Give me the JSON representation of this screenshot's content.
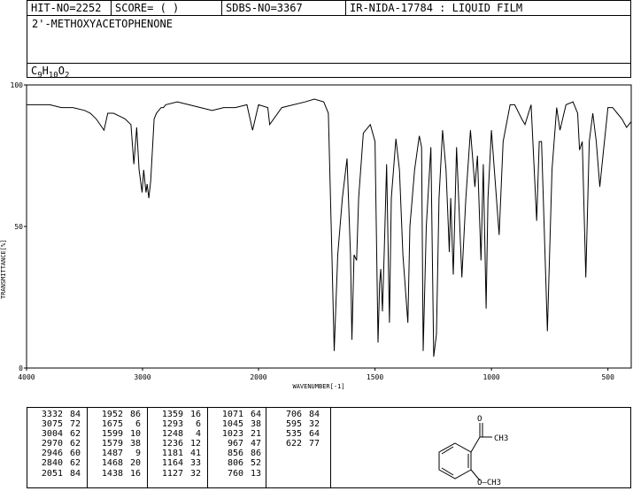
{
  "header": {
    "hit_no": "HIT-NO=2252",
    "score": "SCORE=  (   )",
    "sdbs_no": "SDBS-NO=3367",
    "ir_id": "IR-NIDA-17784 : LIQUID FILM",
    "compound_name": "2'-METHOXYACETOPHENONE",
    "formula": {
      "c": "C",
      "c_n": "9",
      "h": "H",
      "h_n": "10",
      "o": "O",
      "o_n": "2"
    }
  },
  "chart_data": {
    "type": "line",
    "xlabel": "WAVENUMBER[-1]",
    "ylabel": "TRANSMITTANCE[%]",
    "xlim": [
      4000,
      400
    ],
    "ylim": [
      0,
      100
    ],
    "x_ticks": [
      4000,
      3000,
      2000,
      1500,
      1000,
      500
    ],
    "y_ticks": [
      0,
      50,
      100
    ],
    "x": [
      4000,
      3900,
      3800,
      3700,
      3600,
      3500,
      3450,
      3400,
      3332,
      3300,
      3250,
      3200,
      3150,
      3100,
      3075,
      3050,
      3030,
      3004,
      2990,
      2970,
      2960,
      2946,
      2930,
      2900,
      2880,
      2860,
      2840,
      2820,
      2800,
      2700,
      2600,
      2500,
      2400,
      2300,
      2200,
      2100,
      2051,
      2000,
      1960,
      1952,
      1900,
      1800,
      1760,
      1720,
      1700,
      1685,
      1675,
      1660,
      1640,
      1620,
      1605,
      1599,
      1590,
      1579,
      1570,
      1550,
      1520,
      1500,
      1487,
      1480,
      1475,
      1468,
      1460,
      1450,
      1438,
      1430,
      1410,
      1395,
      1380,
      1359,
      1350,
      1330,
      1310,
      1300,
      1293,
      1280,
      1260,
      1248,
      1236,
      1225,
      1210,
      1195,
      1185,
      1181,
      1175,
      1164,
      1150,
      1127,
      1110,
      1090,
      1071,
      1060,
      1045,
      1035,
      1023,
      1015,
      1000,
      967,
      950,
      920,
      900,
      870,
      856,
      830,
      806,
      795,
      785,
      760,
      740,
      720,
      706,
      680,
      650,
      630,
      622,
      610,
      595,
      580,
      565,
      550,
      535,
      520,
      500,
      480,
      460,
      440,
      420,
      400
    ],
    "y": [
      93,
      93,
      93,
      92,
      92,
      91,
      90,
      88,
      84,
      90,
      90,
      89,
      88,
      86,
      72,
      85,
      70,
      62,
      70,
      62,
      65,
      60,
      66,
      88,
      90,
      91,
      92,
      92,
      93,
      94,
      93,
      92,
      91,
      92,
      92,
      93,
      84,
      93,
      92,
      86,
      92,
      94,
      95,
      94,
      90,
      40,
      6,
      40,
      60,
      74,
      40,
      10,
      40,
      38,
      60,
      83,
      86,
      80,
      9,
      30,
      35,
      20,
      42,
      72,
      16,
      60,
      81,
      70,
      40,
      16,
      50,
      70,
      82,
      78,
      6,
      50,
      78,
      4,
      12,
      60,
      84,
      70,
      50,
      41,
      60,
      33,
      78,
      32,
      60,
      84,
      64,
      75,
      38,
      72,
      21,
      60,
      84,
      47,
      80,
      93,
      93,
      88,
      86,
      93,
      52,
      80,
      80,
      13,
      70,
      92,
      84,
      93,
      94,
      90,
      77,
      80,
      32,
      80,
      90,
      80,
      64,
      76,
      92,
      92,
      90,
      88,
      85,
      87
    ],
    "peak_table": {
      "columns": [
        [
          [
            "3332",
            "84"
          ],
          [
            "3075",
            "72"
          ],
          [
            "3004",
            "62"
          ],
          [
            "2970",
            "62"
          ],
          [
            "2946",
            "60"
          ],
          [
            "2840",
            "62"
          ],
          [
            "2051",
            "84"
          ]
        ],
        [
          [
            "1952",
            "86"
          ],
          [
            "1675",
            "6"
          ],
          [
            "1599",
            "10"
          ],
          [
            "1579",
            "38"
          ],
          [
            "1487",
            "9"
          ],
          [
            "1468",
            "20"
          ],
          [
            "1438",
            "16"
          ]
        ],
        [
          [
            "1359",
            "16"
          ],
          [
            "1293",
            "6"
          ],
          [
            "1248",
            "4"
          ],
          [
            "1236",
            "12"
          ],
          [
            "1181",
            "41"
          ],
          [
            "1164",
            "33"
          ],
          [
            "1127",
            "32"
          ]
        ],
        [
          [
            "1071",
            "64"
          ],
          [
            "1045",
            "38"
          ],
          [
            "1023",
            "21"
          ],
          [
            "967",
            "47"
          ],
          [
            "856",
            "86"
          ],
          [
            "806",
            "52"
          ],
          [
            "760",
            "13"
          ]
        ],
        [
          [
            "706",
            "84"
          ],
          [
            "595",
            "32"
          ],
          [
            "535",
            "64"
          ],
          [
            "622",
            "77"
          ]
        ]
      ]
    },
    "structure_labels": {
      "carbonyl_o": "O",
      "methyl": "CH3",
      "methoxy": "O—CH3"
    }
  }
}
